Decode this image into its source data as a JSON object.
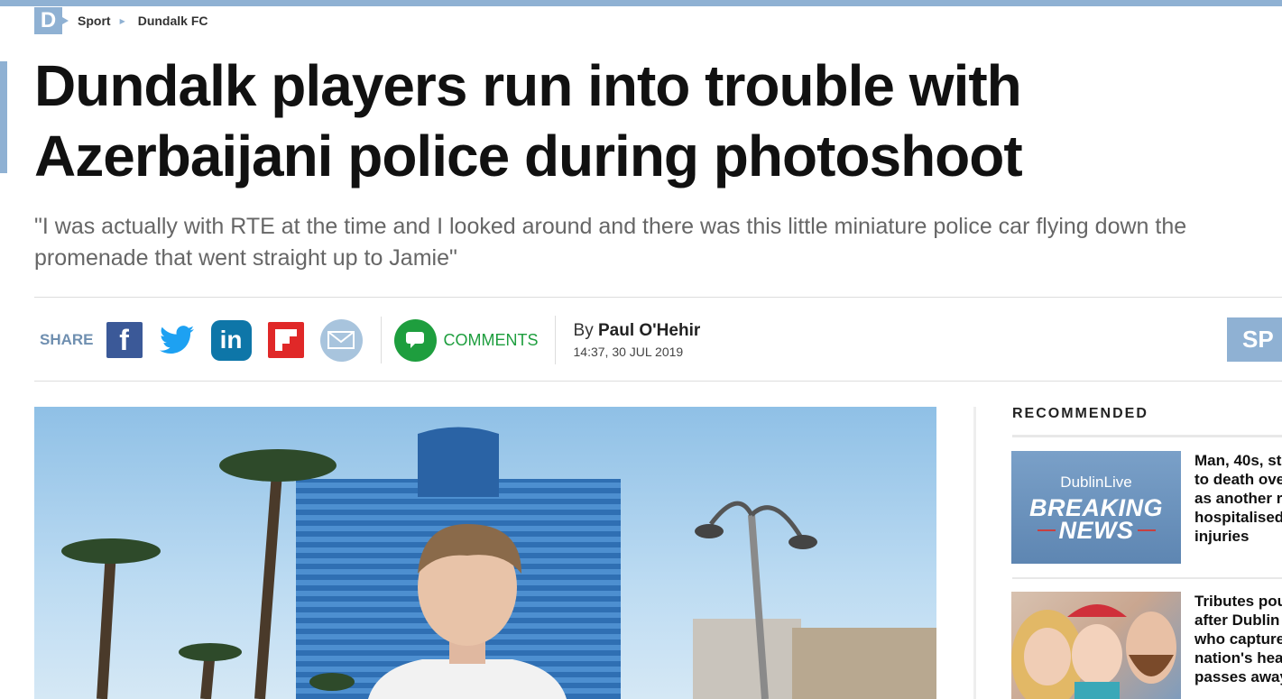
{
  "breadcrumb": {
    "logo": "D",
    "items": [
      "Sport",
      "Dundalk FC"
    ]
  },
  "article": {
    "headline": "Dundalk players run into trouble with Azerbaijani police during photoshoot",
    "standfirst": "\"I was actually with RTE at the time and I looked around and there was this little miniature police car flying down the promenade that went straight up to Jamie\"",
    "author_prefix": "By",
    "author": "Paul O'Hehir",
    "timestamp": "14:37, 30 JUL 2019"
  },
  "share": {
    "label": "SHARE",
    "buttons": [
      "facebook-icon",
      "twitter-icon",
      "linkedin-icon",
      "flipboard-icon",
      "email-icon"
    ],
    "linkedin_text": "in",
    "facebook_text": "f",
    "comments_label": "COMMENTS"
  },
  "section_button": {
    "label": "SP"
  },
  "sidebar": {
    "title": "RECOMMENDED",
    "items": [
      {
        "image_brand": "DublinLive",
        "image_line1": "BREAKING",
        "image_line2": "NEWS",
        "lines": [
          "Man, 40s, st",
          "to death ove",
          "as another r",
          "hospitalised",
          "injuries"
        ]
      },
      {
        "lines": [
          "Tributes pou",
          "after Dublin",
          "who capture",
          "nation's hea",
          "passes away"
        ]
      }
    ]
  },
  "colors": {
    "accent": "#8fb1d3",
    "facebook": "#3b5998",
    "twitter": "#1da1f2",
    "linkedin": "#0e76a8",
    "flipboard": "#e02828",
    "comments": "#1e9e3e"
  }
}
